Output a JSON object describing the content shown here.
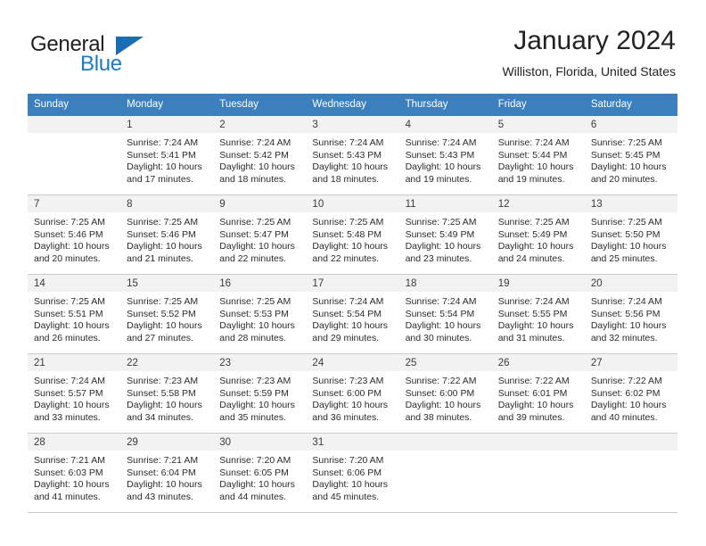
{
  "brand": {
    "name_top": "General",
    "name_bottom": "Blue",
    "triangle_icon": "triangle-icon",
    "accent_color": "#1b7bc4"
  },
  "header": {
    "title": "January 2024",
    "location": "Williston, Florida, United States"
  },
  "theme": {
    "header_bg": "#3b7fbf",
    "header_text": "#ffffff",
    "day_band_bg": "#f2f2f2",
    "cell_bg": "#ffffff",
    "row_divider": "#c9c9c9",
    "body_text": "#2b2b2b"
  },
  "calendar": {
    "weekday_headers": [
      "Sunday",
      "Monday",
      "Tuesday",
      "Wednesday",
      "Thursday",
      "Friday",
      "Saturday"
    ],
    "weeks": [
      [
        {
          "day": "",
          "empty": true,
          "sunrise": "",
          "sunset": "",
          "daylight_line1": "",
          "daylight_line2": ""
        },
        {
          "day": "1",
          "sunrise": "Sunrise: 7:24 AM",
          "sunset": "Sunset: 5:41 PM",
          "daylight_line1": "Daylight: 10 hours",
          "daylight_line2": "and 17 minutes."
        },
        {
          "day": "2",
          "sunrise": "Sunrise: 7:24 AM",
          "sunset": "Sunset: 5:42 PM",
          "daylight_line1": "Daylight: 10 hours",
          "daylight_line2": "and 18 minutes."
        },
        {
          "day": "3",
          "sunrise": "Sunrise: 7:24 AM",
          "sunset": "Sunset: 5:43 PM",
          "daylight_line1": "Daylight: 10 hours",
          "daylight_line2": "and 18 minutes."
        },
        {
          "day": "4",
          "sunrise": "Sunrise: 7:24 AM",
          "sunset": "Sunset: 5:43 PM",
          "daylight_line1": "Daylight: 10 hours",
          "daylight_line2": "and 19 minutes."
        },
        {
          "day": "5",
          "sunrise": "Sunrise: 7:24 AM",
          "sunset": "Sunset: 5:44 PM",
          "daylight_line1": "Daylight: 10 hours",
          "daylight_line2": "and 19 minutes."
        },
        {
          "day": "6",
          "sunrise": "Sunrise: 7:25 AM",
          "sunset": "Sunset: 5:45 PM",
          "daylight_line1": "Daylight: 10 hours",
          "daylight_line2": "and 20 minutes."
        }
      ],
      [
        {
          "day": "7",
          "sunrise": "Sunrise: 7:25 AM",
          "sunset": "Sunset: 5:46 PM",
          "daylight_line1": "Daylight: 10 hours",
          "daylight_line2": "and 20 minutes."
        },
        {
          "day": "8",
          "sunrise": "Sunrise: 7:25 AM",
          "sunset": "Sunset: 5:46 PM",
          "daylight_line1": "Daylight: 10 hours",
          "daylight_line2": "and 21 minutes."
        },
        {
          "day": "9",
          "sunrise": "Sunrise: 7:25 AM",
          "sunset": "Sunset: 5:47 PM",
          "daylight_line1": "Daylight: 10 hours",
          "daylight_line2": "and 22 minutes."
        },
        {
          "day": "10",
          "sunrise": "Sunrise: 7:25 AM",
          "sunset": "Sunset: 5:48 PM",
          "daylight_line1": "Daylight: 10 hours",
          "daylight_line2": "and 22 minutes."
        },
        {
          "day": "11",
          "sunrise": "Sunrise: 7:25 AM",
          "sunset": "Sunset: 5:49 PM",
          "daylight_line1": "Daylight: 10 hours",
          "daylight_line2": "and 23 minutes."
        },
        {
          "day": "12",
          "sunrise": "Sunrise: 7:25 AM",
          "sunset": "Sunset: 5:49 PM",
          "daylight_line1": "Daylight: 10 hours",
          "daylight_line2": "and 24 minutes."
        },
        {
          "day": "13",
          "sunrise": "Sunrise: 7:25 AM",
          "sunset": "Sunset: 5:50 PM",
          "daylight_line1": "Daylight: 10 hours",
          "daylight_line2": "and 25 minutes."
        }
      ],
      [
        {
          "day": "14",
          "sunrise": "Sunrise: 7:25 AM",
          "sunset": "Sunset: 5:51 PM",
          "daylight_line1": "Daylight: 10 hours",
          "daylight_line2": "and 26 minutes."
        },
        {
          "day": "15",
          "sunrise": "Sunrise: 7:25 AM",
          "sunset": "Sunset: 5:52 PM",
          "daylight_line1": "Daylight: 10 hours",
          "daylight_line2": "and 27 minutes."
        },
        {
          "day": "16",
          "sunrise": "Sunrise: 7:25 AM",
          "sunset": "Sunset: 5:53 PM",
          "daylight_line1": "Daylight: 10 hours",
          "daylight_line2": "and 28 minutes."
        },
        {
          "day": "17",
          "sunrise": "Sunrise: 7:24 AM",
          "sunset": "Sunset: 5:54 PM",
          "daylight_line1": "Daylight: 10 hours",
          "daylight_line2": "and 29 minutes."
        },
        {
          "day": "18",
          "sunrise": "Sunrise: 7:24 AM",
          "sunset": "Sunset: 5:54 PM",
          "daylight_line1": "Daylight: 10 hours",
          "daylight_line2": "and 30 minutes."
        },
        {
          "day": "19",
          "sunrise": "Sunrise: 7:24 AM",
          "sunset": "Sunset: 5:55 PM",
          "daylight_line1": "Daylight: 10 hours",
          "daylight_line2": "and 31 minutes."
        },
        {
          "day": "20",
          "sunrise": "Sunrise: 7:24 AM",
          "sunset": "Sunset: 5:56 PM",
          "daylight_line1": "Daylight: 10 hours",
          "daylight_line2": "and 32 minutes."
        }
      ],
      [
        {
          "day": "21",
          "sunrise": "Sunrise: 7:24 AM",
          "sunset": "Sunset: 5:57 PM",
          "daylight_line1": "Daylight: 10 hours",
          "daylight_line2": "and 33 minutes."
        },
        {
          "day": "22",
          "sunrise": "Sunrise: 7:23 AM",
          "sunset": "Sunset: 5:58 PM",
          "daylight_line1": "Daylight: 10 hours",
          "daylight_line2": "and 34 minutes."
        },
        {
          "day": "23",
          "sunrise": "Sunrise: 7:23 AM",
          "sunset": "Sunset: 5:59 PM",
          "daylight_line1": "Daylight: 10 hours",
          "daylight_line2": "and 35 minutes."
        },
        {
          "day": "24",
          "sunrise": "Sunrise: 7:23 AM",
          "sunset": "Sunset: 6:00 PM",
          "daylight_line1": "Daylight: 10 hours",
          "daylight_line2": "and 36 minutes."
        },
        {
          "day": "25",
          "sunrise": "Sunrise: 7:22 AM",
          "sunset": "Sunset: 6:00 PM",
          "daylight_line1": "Daylight: 10 hours",
          "daylight_line2": "and 38 minutes."
        },
        {
          "day": "26",
          "sunrise": "Sunrise: 7:22 AM",
          "sunset": "Sunset: 6:01 PM",
          "daylight_line1": "Daylight: 10 hours",
          "daylight_line2": "and 39 minutes."
        },
        {
          "day": "27",
          "sunrise": "Sunrise: 7:22 AM",
          "sunset": "Sunset: 6:02 PM",
          "daylight_line1": "Daylight: 10 hours",
          "daylight_line2": "and 40 minutes."
        }
      ],
      [
        {
          "day": "28",
          "sunrise": "Sunrise: 7:21 AM",
          "sunset": "Sunset: 6:03 PM",
          "daylight_line1": "Daylight: 10 hours",
          "daylight_line2": "and 41 minutes."
        },
        {
          "day": "29",
          "sunrise": "Sunrise: 7:21 AM",
          "sunset": "Sunset: 6:04 PM",
          "daylight_line1": "Daylight: 10 hours",
          "daylight_line2": "and 43 minutes."
        },
        {
          "day": "30",
          "sunrise": "Sunrise: 7:20 AM",
          "sunset": "Sunset: 6:05 PM",
          "daylight_line1": "Daylight: 10 hours",
          "daylight_line2": "and 44 minutes."
        },
        {
          "day": "31",
          "sunrise": "Sunrise: 7:20 AM",
          "sunset": "Sunset: 6:06 PM",
          "daylight_line1": "Daylight: 10 hours",
          "daylight_line2": "and 45 minutes."
        },
        {
          "day": "",
          "empty": true,
          "sunrise": "",
          "sunset": "",
          "daylight_line1": "",
          "daylight_line2": ""
        },
        {
          "day": "",
          "empty": true,
          "sunrise": "",
          "sunset": "",
          "daylight_line1": "",
          "daylight_line2": ""
        },
        {
          "day": "",
          "empty": true,
          "sunrise": "",
          "sunset": "",
          "daylight_line1": "",
          "daylight_line2": ""
        }
      ]
    ]
  }
}
